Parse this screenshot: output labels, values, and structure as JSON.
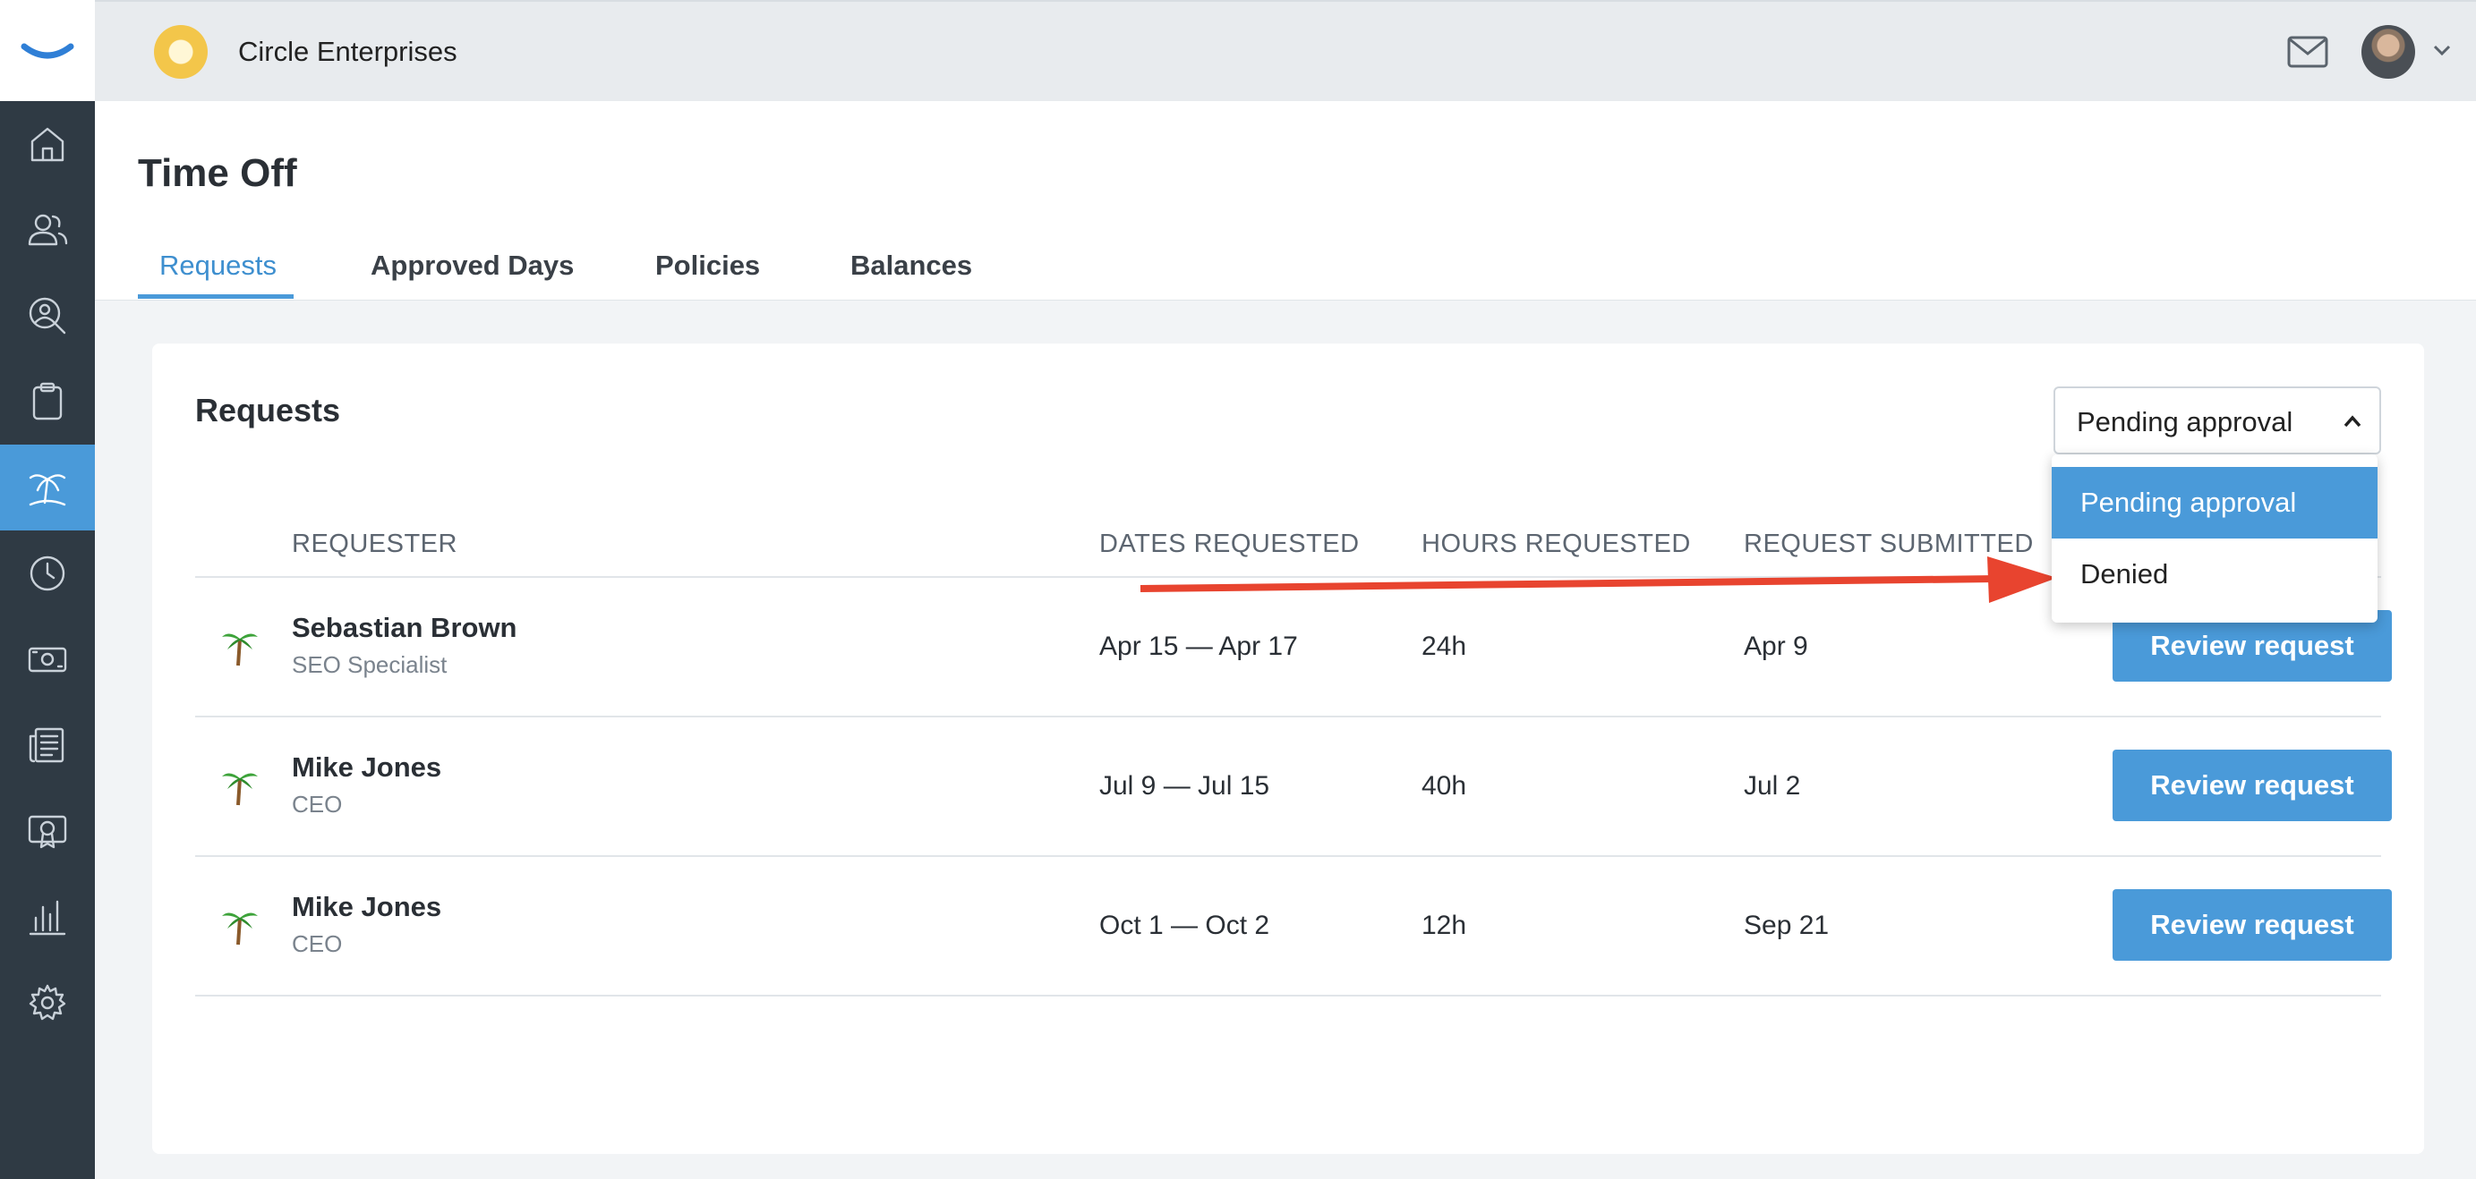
{
  "app": {
    "company_name": "Circle Enterprises"
  },
  "sidebar": {
    "items": [
      {
        "icon": "home-icon"
      },
      {
        "icon": "people-icon"
      },
      {
        "icon": "user-search-icon"
      },
      {
        "icon": "clipboard-icon"
      },
      {
        "icon": "palm-tree-icon",
        "active": true
      },
      {
        "icon": "clock-icon"
      },
      {
        "icon": "money-icon"
      },
      {
        "icon": "newspaper-icon"
      },
      {
        "icon": "certificate-icon"
      },
      {
        "icon": "bar-chart-icon"
      },
      {
        "icon": "gear-icon"
      }
    ]
  },
  "page": {
    "title": "Time Off",
    "tabs": [
      {
        "label": "Requests",
        "active": true
      },
      {
        "label": "Approved Days"
      },
      {
        "label": "Policies"
      },
      {
        "label": "Balances"
      }
    ]
  },
  "requests": {
    "title": "Requests",
    "filter": {
      "value": "Pending approval",
      "options": [
        "Pending approval",
        "Denied"
      ]
    },
    "columns": [
      "REQUESTER",
      "DATES REQUESTED",
      "HOURS REQUESTED",
      "REQUEST SUBMITTED"
    ],
    "rows": [
      {
        "name": "Sebastian Brown",
        "role": "SEO Specialist",
        "dates": "Apr 15 — Apr 17",
        "hours": "24h",
        "submitted": "Apr 9",
        "action": "Review request"
      },
      {
        "name": "Mike Jones",
        "role": "CEO",
        "dates": "Jul 9 — Jul 15",
        "hours": "40h",
        "submitted": "Jul 2",
        "action": "Review request"
      },
      {
        "name": "Mike Jones",
        "role": "CEO",
        "dates": "Oct 1 — Oct 2",
        "hours": "12h",
        "submitted": "Sep 21",
        "action": "Review request"
      }
    ]
  },
  "colors": {
    "accent": "#4a9ad9",
    "sidebar": "#2f3a44",
    "annotation_arrow": "#e8442f"
  }
}
